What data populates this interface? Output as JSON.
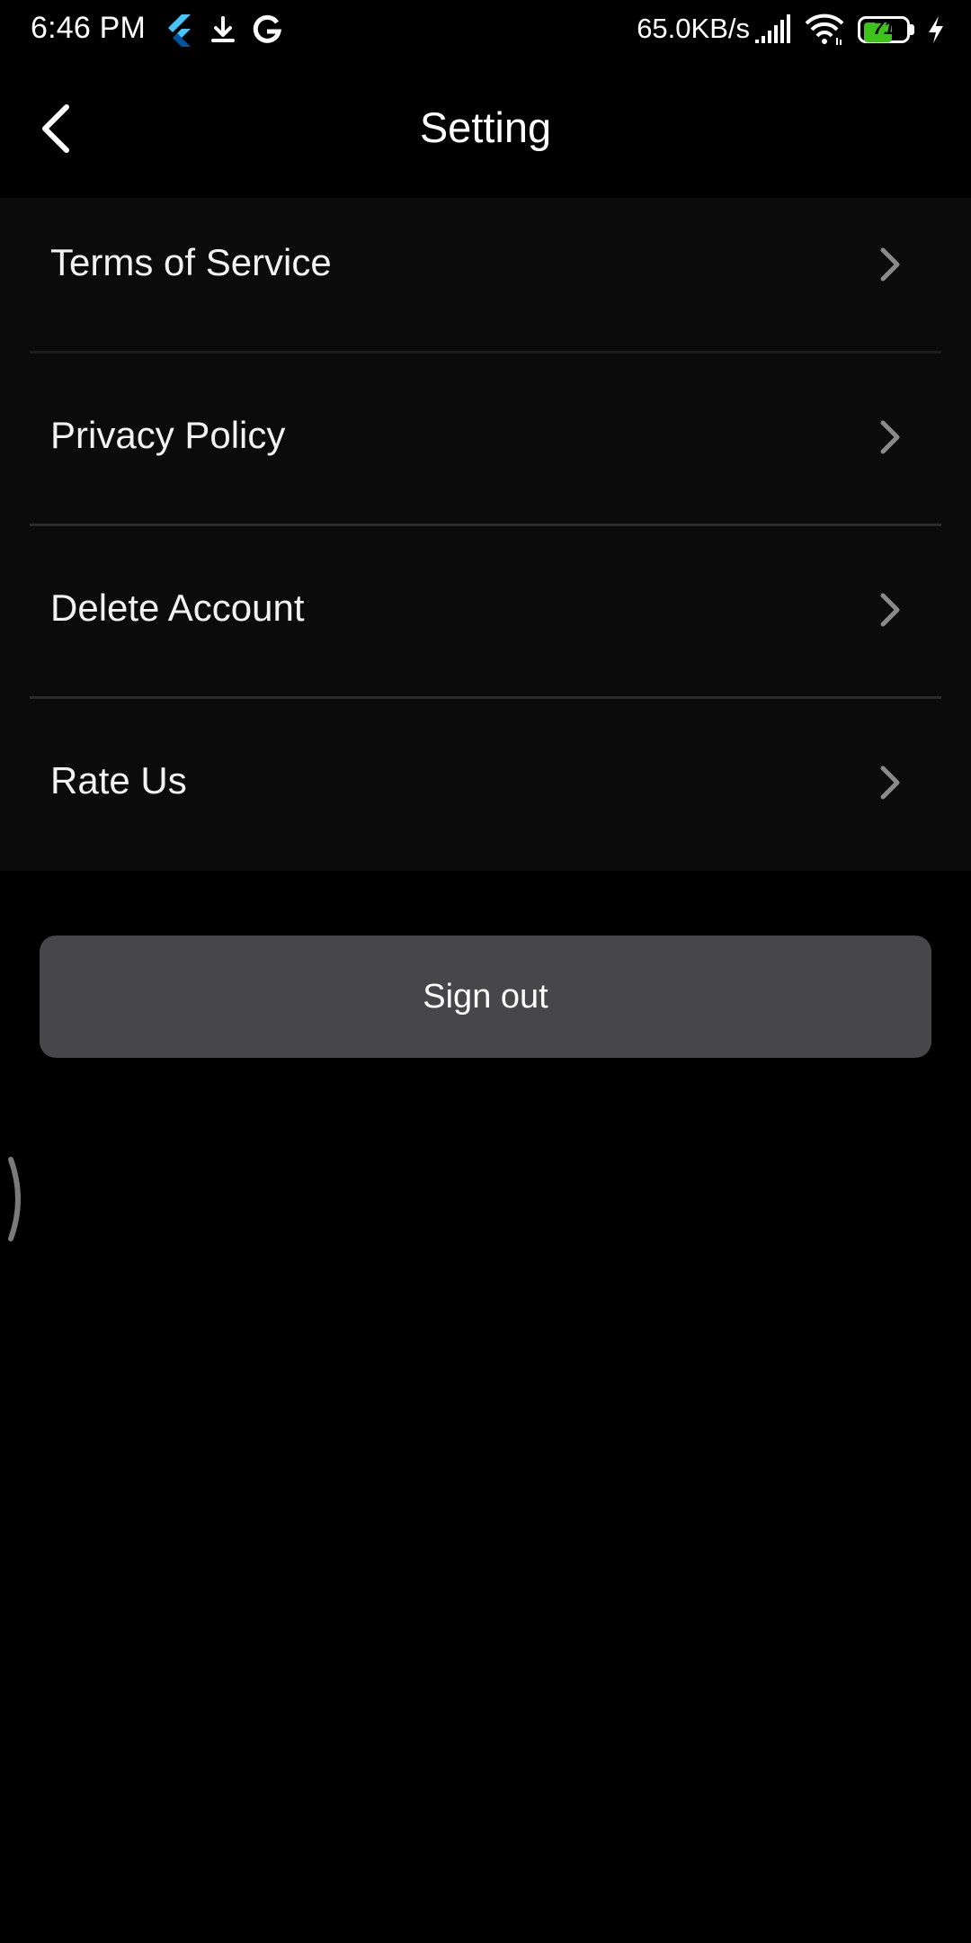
{
  "status_bar": {
    "time": "6:46 PM",
    "net_speed": "65.0KB/s",
    "battery_level": "71",
    "battery_fraction": 0.71,
    "battery_color": "#3ec21c",
    "icons": [
      "flutter-icon",
      "download-icon",
      "google-icon",
      "signal-icon",
      "wifi-icon",
      "charging-bolt-icon"
    ]
  },
  "header": {
    "title": "Setting",
    "back_icon": "chevron-left-icon"
  },
  "settings": {
    "items": [
      {
        "label": "Terms of Service",
        "icon": "chevron-right-icon"
      },
      {
        "label": "Privacy Policy",
        "icon": "chevron-right-icon"
      },
      {
        "label": "Delete Account",
        "icon": "chevron-right-icon"
      },
      {
        "label": "Rate Us",
        "icon": "chevron-right-icon"
      }
    ]
  },
  "actions": {
    "sign_out_label": "Sign out"
  },
  "colors": {
    "background": "#000000",
    "list_background": "#0b0b0b",
    "button_background": "#474749",
    "divider": "#2a2a2a",
    "chevron": "#8a8a8a"
  }
}
